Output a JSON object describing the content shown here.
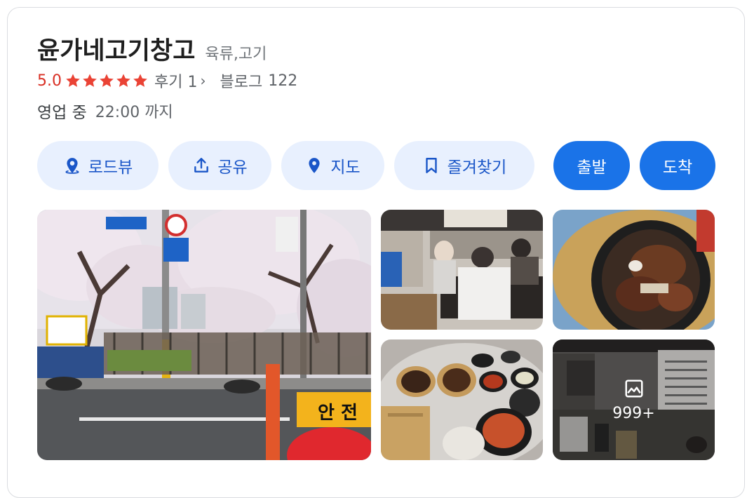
{
  "place": {
    "name": "윤가네고기창고",
    "category": "육류,고기"
  },
  "rating": {
    "value": "5.0",
    "stars": 5,
    "reviews_label": "후기 1",
    "blog_label": "블로그",
    "blog_count": "122"
  },
  "hours": {
    "status": "영업 중",
    "closes": "22:00 까지"
  },
  "actions": {
    "roadview": "로드뷰",
    "share": "공유",
    "map": "지도",
    "bookmark": "즐겨찾기",
    "depart": "출발",
    "arrive": "도착"
  },
  "photos": {
    "more_count": "999+"
  },
  "colors": {
    "accent": "#1a73e8",
    "rating": "#d93025",
    "action_bg": "#e8f0fe"
  }
}
